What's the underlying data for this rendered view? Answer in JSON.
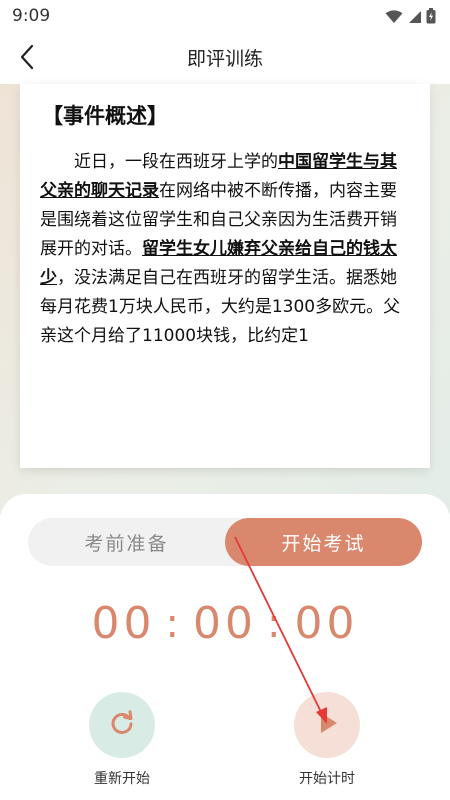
{
  "status_bar": {
    "time": "9:09",
    "icons": [
      "wifi-icon",
      "cellular-signal-icon",
      "battery-icon"
    ]
  },
  "header": {
    "title": "即评训练",
    "back_icon": "back-arrow-icon"
  },
  "article": {
    "heading": "【事件概述】",
    "segments": [
      {
        "text": "近日，一段在西班牙上学的",
        "bold": false
      },
      {
        "text": "中国留学生与其父亲的聊天记录",
        "bold": true
      },
      {
        "text": "在网络中被不断传播，内容主要是围绕着这位留学生和自己父亲因为生活费开销展开的对话。",
        "bold": false
      },
      {
        "text": "留学生女儿嫌弃父亲给自己的钱太少",
        "bold": true
      },
      {
        "text": "，没法满足自己在西班牙的留学生活。据悉她每月花费1万块人民币，大约是1300多欧元。父亲这个月给了11000块钱，比约定1",
        "bold": false
      }
    ]
  },
  "mode_toggle": {
    "left_label": "考前准备",
    "right_label": "开始考试",
    "selected": "开始考试"
  },
  "timer": {
    "hours": "00",
    "minutes": "00",
    "seconds": "00",
    "separator": ":"
  },
  "controls": {
    "restart_label": "重新开始",
    "restart_icon": "refresh-icon",
    "start_label": "开始计时",
    "start_icon": "play-icon"
  },
  "colors": {
    "accent": "#d9876d",
    "restart_bg": "#d8ece5",
    "start_bg": "#f6dfd6",
    "annotation_arrow": "#e53935"
  }
}
